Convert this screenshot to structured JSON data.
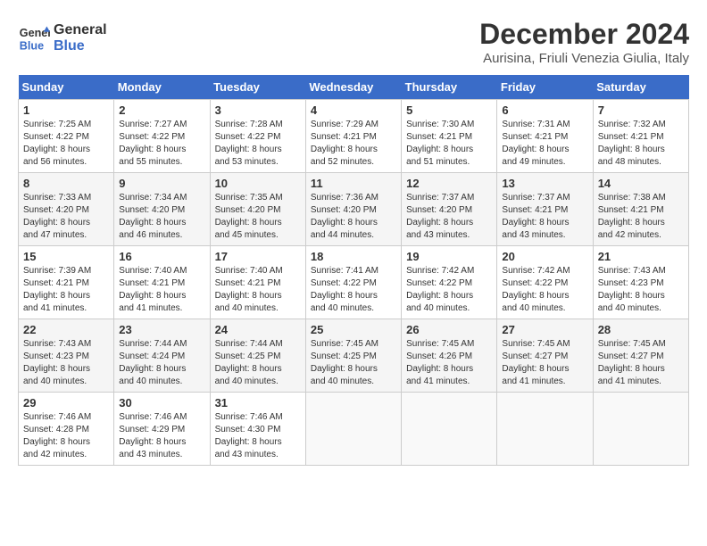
{
  "header": {
    "logo_line1": "General",
    "logo_line2": "Blue",
    "month_year": "December 2024",
    "location": "Aurisina, Friuli Venezia Giulia, Italy"
  },
  "days_of_week": [
    "Sunday",
    "Monday",
    "Tuesday",
    "Wednesday",
    "Thursday",
    "Friday",
    "Saturday"
  ],
  "weeks": [
    [
      {
        "day": 1,
        "info": "Sunrise: 7:25 AM\nSunset: 4:22 PM\nDaylight: 8 hours\nand 56 minutes."
      },
      {
        "day": 2,
        "info": "Sunrise: 7:27 AM\nSunset: 4:22 PM\nDaylight: 8 hours\nand 55 minutes."
      },
      {
        "day": 3,
        "info": "Sunrise: 7:28 AM\nSunset: 4:22 PM\nDaylight: 8 hours\nand 53 minutes."
      },
      {
        "day": 4,
        "info": "Sunrise: 7:29 AM\nSunset: 4:21 PM\nDaylight: 8 hours\nand 52 minutes."
      },
      {
        "day": 5,
        "info": "Sunrise: 7:30 AM\nSunset: 4:21 PM\nDaylight: 8 hours\nand 51 minutes."
      },
      {
        "day": 6,
        "info": "Sunrise: 7:31 AM\nSunset: 4:21 PM\nDaylight: 8 hours\nand 49 minutes."
      },
      {
        "day": 7,
        "info": "Sunrise: 7:32 AM\nSunset: 4:21 PM\nDaylight: 8 hours\nand 48 minutes."
      }
    ],
    [
      {
        "day": 8,
        "info": "Sunrise: 7:33 AM\nSunset: 4:20 PM\nDaylight: 8 hours\nand 47 minutes."
      },
      {
        "day": 9,
        "info": "Sunrise: 7:34 AM\nSunset: 4:20 PM\nDaylight: 8 hours\nand 46 minutes."
      },
      {
        "day": 10,
        "info": "Sunrise: 7:35 AM\nSunset: 4:20 PM\nDaylight: 8 hours\nand 45 minutes."
      },
      {
        "day": 11,
        "info": "Sunrise: 7:36 AM\nSunset: 4:20 PM\nDaylight: 8 hours\nand 44 minutes."
      },
      {
        "day": 12,
        "info": "Sunrise: 7:37 AM\nSunset: 4:20 PM\nDaylight: 8 hours\nand 43 minutes."
      },
      {
        "day": 13,
        "info": "Sunrise: 7:37 AM\nSunset: 4:21 PM\nDaylight: 8 hours\nand 43 minutes."
      },
      {
        "day": 14,
        "info": "Sunrise: 7:38 AM\nSunset: 4:21 PM\nDaylight: 8 hours\nand 42 minutes."
      }
    ],
    [
      {
        "day": 15,
        "info": "Sunrise: 7:39 AM\nSunset: 4:21 PM\nDaylight: 8 hours\nand 41 minutes."
      },
      {
        "day": 16,
        "info": "Sunrise: 7:40 AM\nSunset: 4:21 PM\nDaylight: 8 hours\nand 41 minutes."
      },
      {
        "day": 17,
        "info": "Sunrise: 7:40 AM\nSunset: 4:21 PM\nDaylight: 8 hours\nand 40 minutes."
      },
      {
        "day": 18,
        "info": "Sunrise: 7:41 AM\nSunset: 4:22 PM\nDaylight: 8 hours\nand 40 minutes."
      },
      {
        "day": 19,
        "info": "Sunrise: 7:42 AM\nSunset: 4:22 PM\nDaylight: 8 hours\nand 40 minutes."
      },
      {
        "day": 20,
        "info": "Sunrise: 7:42 AM\nSunset: 4:22 PM\nDaylight: 8 hours\nand 40 minutes."
      },
      {
        "day": 21,
        "info": "Sunrise: 7:43 AM\nSunset: 4:23 PM\nDaylight: 8 hours\nand 40 minutes."
      }
    ],
    [
      {
        "day": 22,
        "info": "Sunrise: 7:43 AM\nSunset: 4:23 PM\nDaylight: 8 hours\nand 40 minutes."
      },
      {
        "day": 23,
        "info": "Sunrise: 7:44 AM\nSunset: 4:24 PM\nDaylight: 8 hours\nand 40 minutes."
      },
      {
        "day": 24,
        "info": "Sunrise: 7:44 AM\nSunset: 4:25 PM\nDaylight: 8 hours\nand 40 minutes."
      },
      {
        "day": 25,
        "info": "Sunrise: 7:45 AM\nSunset: 4:25 PM\nDaylight: 8 hours\nand 40 minutes."
      },
      {
        "day": 26,
        "info": "Sunrise: 7:45 AM\nSunset: 4:26 PM\nDaylight: 8 hours\nand 41 minutes."
      },
      {
        "day": 27,
        "info": "Sunrise: 7:45 AM\nSunset: 4:27 PM\nDaylight: 8 hours\nand 41 minutes."
      },
      {
        "day": 28,
        "info": "Sunrise: 7:45 AM\nSunset: 4:27 PM\nDaylight: 8 hours\nand 41 minutes."
      }
    ],
    [
      {
        "day": 29,
        "info": "Sunrise: 7:46 AM\nSunset: 4:28 PM\nDaylight: 8 hours\nand 42 minutes."
      },
      {
        "day": 30,
        "info": "Sunrise: 7:46 AM\nSunset: 4:29 PM\nDaylight: 8 hours\nand 43 minutes."
      },
      {
        "day": 31,
        "info": "Sunrise: 7:46 AM\nSunset: 4:30 PM\nDaylight: 8 hours\nand 43 minutes."
      },
      null,
      null,
      null,
      null
    ]
  ]
}
